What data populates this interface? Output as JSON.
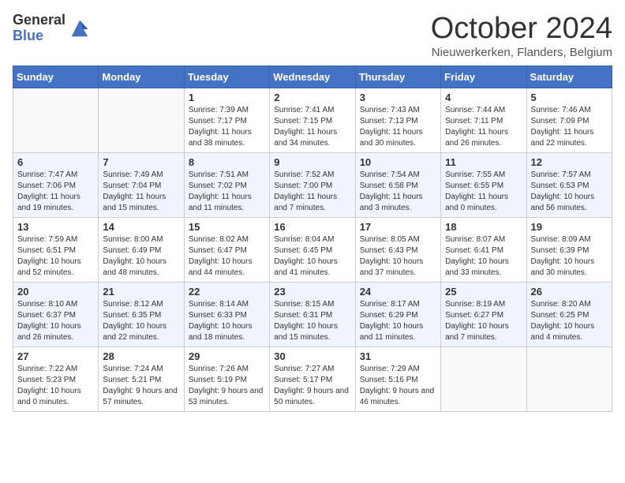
{
  "header": {
    "logo_general": "General",
    "logo_blue": "Blue",
    "month": "October 2024",
    "location": "Nieuwerkerken, Flanders, Belgium"
  },
  "weekdays": [
    "Sunday",
    "Monday",
    "Tuesday",
    "Wednesday",
    "Thursday",
    "Friday",
    "Saturday"
  ],
  "weeks": [
    [
      {
        "num": "",
        "sunrise": "",
        "sunset": "",
        "daylight": ""
      },
      {
        "num": "",
        "sunrise": "",
        "sunset": "",
        "daylight": ""
      },
      {
        "num": "1",
        "sunrise": "Sunrise: 7:39 AM",
        "sunset": "Sunset: 7:17 PM",
        "daylight": "Daylight: 11 hours and 38 minutes."
      },
      {
        "num": "2",
        "sunrise": "Sunrise: 7:41 AM",
        "sunset": "Sunset: 7:15 PM",
        "daylight": "Daylight: 11 hours and 34 minutes."
      },
      {
        "num": "3",
        "sunrise": "Sunrise: 7:43 AM",
        "sunset": "Sunset: 7:13 PM",
        "daylight": "Daylight: 11 hours and 30 minutes."
      },
      {
        "num": "4",
        "sunrise": "Sunrise: 7:44 AM",
        "sunset": "Sunset: 7:11 PM",
        "daylight": "Daylight: 11 hours and 26 minutes."
      },
      {
        "num": "5",
        "sunrise": "Sunrise: 7:46 AM",
        "sunset": "Sunset: 7:09 PM",
        "daylight": "Daylight: 11 hours and 22 minutes."
      }
    ],
    [
      {
        "num": "6",
        "sunrise": "Sunrise: 7:47 AM",
        "sunset": "Sunset: 7:06 PM",
        "daylight": "Daylight: 11 hours and 19 minutes."
      },
      {
        "num": "7",
        "sunrise": "Sunrise: 7:49 AM",
        "sunset": "Sunset: 7:04 PM",
        "daylight": "Daylight: 11 hours and 15 minutes."
      },
      {
        "num": "8",
        "sunrise": "Sunrise: 7:51 AM",
        "sunset": "Sunset: 7:02 PM",
        "daylight": "Daylight: 11 hours and 11 minutes."
      },
      {
        "num": "9",
        "sunrise": "Sunrise: 7:52 AM",
        "sunset": "Sunset: 7:00 PM",
        "daylight": "Daylight: 11 hours and 7 minutes."
      },
      {
        "num": "10",
        "sunrise": "Sunrise: 7:54 AM",
        "sunset": "Sunset: 6:58 PM",
        "daylight": "Daylight: 11 hours and 3 minutes."
      },
      {
        "num": "11",
        "sunrise": "Sunrise: 7:55 AM",
        "sunset": "Sunset: 6:55 PM",
        "daylight": "Daylight: 11 hours and 0 minutes."
      },
      {
        "num": "12",
        "sunrise": "Sunrise: 7:57 AM",
        "sunset": "Sunset: 6:53 PM",
        "daylight": "Daylight: 10 hours and 56 minutes."
      }
    ],
    [
      {
        "num": "13",
        "sunrise": "Sunrise: 7:59 AM",
        "sunset": "Sunset: 6:51 PM",
        "daylight": "Daylight: 10 hours and 52 minutes."
      },
      {
        "num": "14",
        "sunrise": "Sunrise: 8:00 AM",
        "sunset": "Sunset: 6:49 PM",
        "daylight": "Daylight: 10 hours and 48 minutes."
      },
      {
        "num": "15",
        "sunrise": "Sunrise: 8:02 AM",
        "sunset": "Sunset: 6:47 PM",
        "daylight": "Daylight: 10 hours and 44 minutes."
      },
      {
        "num": "16",
        "sunrise": "Sunrise: 8:04 AM",
        "sunset": "Sunset: 6:45 PM",
        "daylight": "Daylight: 10 hours and 41 minutes."
      },
      {
        "num": "17",
        "sunrise": "Sunrise: 8:05 AM",
        "sunset": "Sunset: 6:43 PM",
        "daylight": "Daylight: 10 hours and 37 minutes."
      },
      {
        "num": "18",
        "sunrise": "Sunrise: 8:07 AM",
        "sunset": "Sunset: 6:41 PM",
        "daylight": "Daylight: 10 hours and 33 minutes."
      },
      {
        "num": "19",
        "sunrise": "Sunrise: 8:09 AM",
        "sunset": "Sunset: 6:39 PM",
        "daylight": "Daylight: 10 hours and 30 minutes."
      }
    ],
    [
      {
        "num": "20",
        "sunrise": "Sunrise: 8:10 AM",
        "sunset": "Sunset: 6:37 PM",
        "daylight": "Daylight: 10 hours and 26 minutes."
      },
      {
        "num": "21",
        "sunrise": "Sunrise: 8:12 AM",
        "sunset": "Sunset: 6:35 PM",
        "daylight": "Daylight: 10 hours and 22 minutes."
      },
      {
        "num": "22",
        "sunrise": "Sunrise: 8:14 AM",
        "sunset": "Sunset: 6:33 PM",
        "daylight": "Daylight: 10 hours and 18 minutes."
      },
      {
        "num": "23",
        "sunrise": "Sunrise: 8:15 AM",
        "sunset": "Sunset: 6:31 PM",
        "daylight": "Daylight: 10 hours and 15 minutes."
      },
      {
        "num": "24",
        "sunrise": "Sunrise: 8:17 AM",
        "sunset": "Sunset: 6:29 PM",
        "daylight": "Daylight: 10 hours and 11 minutes."
      },
      {
        "num": "25",
        "sunrise": "Sunrise: 8:19 AM",
        "sunset": "Sunset: 6:27 PM",
        "daylight": "Daylight: 10 hours and 7 minutes."
      },
      {
        "num": "26",
        "sunrise": "Sunrise: 8:20 AM",
        "sunset": "Sunset: 6:25 PM",
        "daylight": "Daylight: 10 hours and 4 minutes."
      }
    ],
    [
      {
        "num": "27",
        "sunrise": "Sunrise: 7:22 AM",
        "sunset": "Sunset: 5:23 PM",
        "daylight": "Daylight: 10 hours and 0 minutes."
      },
      {
        "num": "28",
        "sunrise": "Sunrise: 7:24 AM",
        "sunset": "Sunset: 5:21 PM",
        "daylight": "Daylight: 9 hours and 57 minutes."
      },
      {
        "num": "29",
        "sunrise": "Sunrise: 7:26 AM",
        "sunset": "Sunset: 5:19 PM",
        "daylight": "Daylight: 9 hours and 53 minutes."
      },
      {
        "num": "30",
        "sunrise": "Sunrise: 7:27 AM",
        "sunset": "Sunset: 5:17 PM",
        "daylight": "Daylight: 9 hours and 50 minutes."
      },
      {
        "num": "31",
        "sunrise": "Sunrise: 7:29 AM",
        "sunset": "Sunset: 5:16 PM",
        "daylight": "Daylight: 9 hours and 46 minutes."
      },
      {
        "num": "",
        "sunrise": "",
        "sunset": "",
        "daylight": ""
      },
      {
        "num": "",
        "sunrise": "",
        "sunset": "",
        "daylight": ""
      }
    ]
  ]
}
